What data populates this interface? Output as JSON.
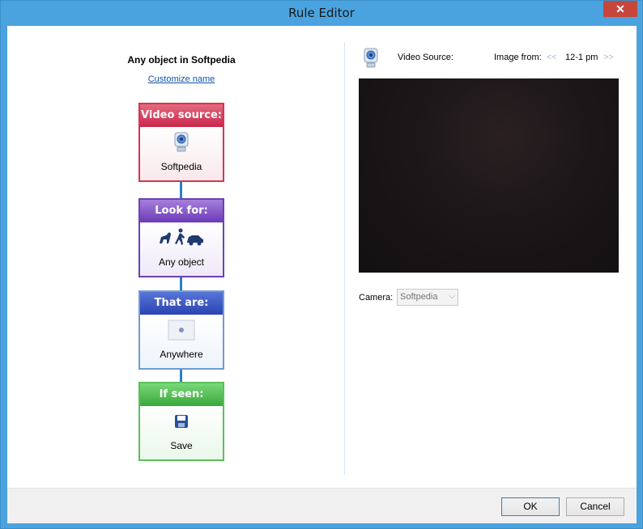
{
  "window": {
    "title": "Rule Editor",
    "close_glyph": "✕"
  },
  "rule": {
    "name": "Any object in Softpedia",
    "customize_link": "Customize name"
  },
  "blocks": [
    {
      "header": "Video source:",
      "label": "Softpedia",
      "icon": "webcam-icon",
      "color": "#d9334f"
    },
    {
      "header": "Look for:",
      "label": "Any object",
      "icon": "objects-icon",
      "color": "#6a42b5"
    },
    {
      "header": "That are:",
      "label": "Anywhere",
      "icon": "area-icon",
      "color": "#2a44b3"
    },
    {
      "header": "If seen:",
      "label": "Save",
      "icon": "save-icon",
      "color": "#39a83b"
    }
  ],
  "preview": {
    "video_source_label": "Video Source:",
    "image_from_label": "Image from:",
    "prev_glyph": "<<",
    "time_range": "12-1 pm",
    "next_glyph": ">>"
  },
  "camera": {
    "label": "Camera:",
    "selected": "Softpedia"
  },
  "footer": {
    "ok_label": "OK",
    "cancel_label": "Cancel"
  }
}
